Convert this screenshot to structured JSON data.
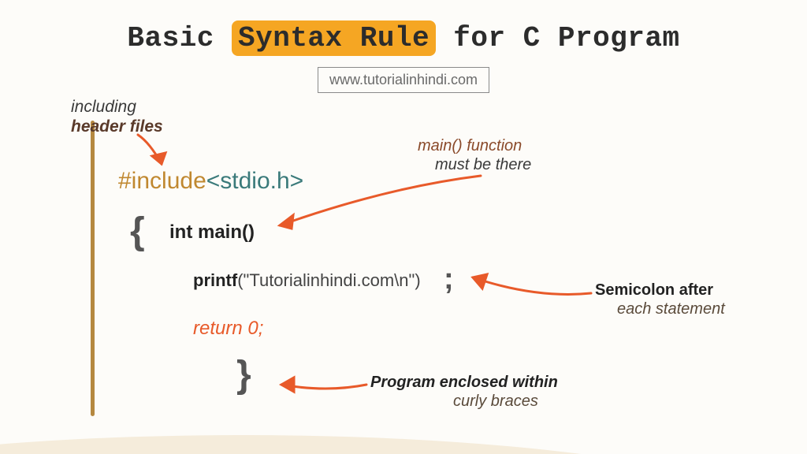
{
  "title": {
    "part1": "Basic ",
    "highlight": "Syntax Rule",
    "part2": " for C Program"
  },
  "url": "www.tutorialinhindi.com",
  "code": {
    "include_keyword": "#include",
    "include_header": "<stdio.h>",
    "brace_open": "{",
    "main_decl": "int main()",
    "printf_fn": "printf",
    "printf_arg": "(\"Tutorialinhindi.com\\n\")",
    "semicolon": ";",
    "return_stmt": "return 0;",
    "brace_close": "}"
  },
  "annotations": {
    "header_line1": "including",
    "header_line2": "header files",
    "main_line1": "main() function",
    "main_line2": "must be there",
    "semi_line1": "Semicolon after",
    "semi_line2": "each statement",
    "braces_line1": "Program enclosed within",
    "braces_line2": "curly braces"
  }
}
